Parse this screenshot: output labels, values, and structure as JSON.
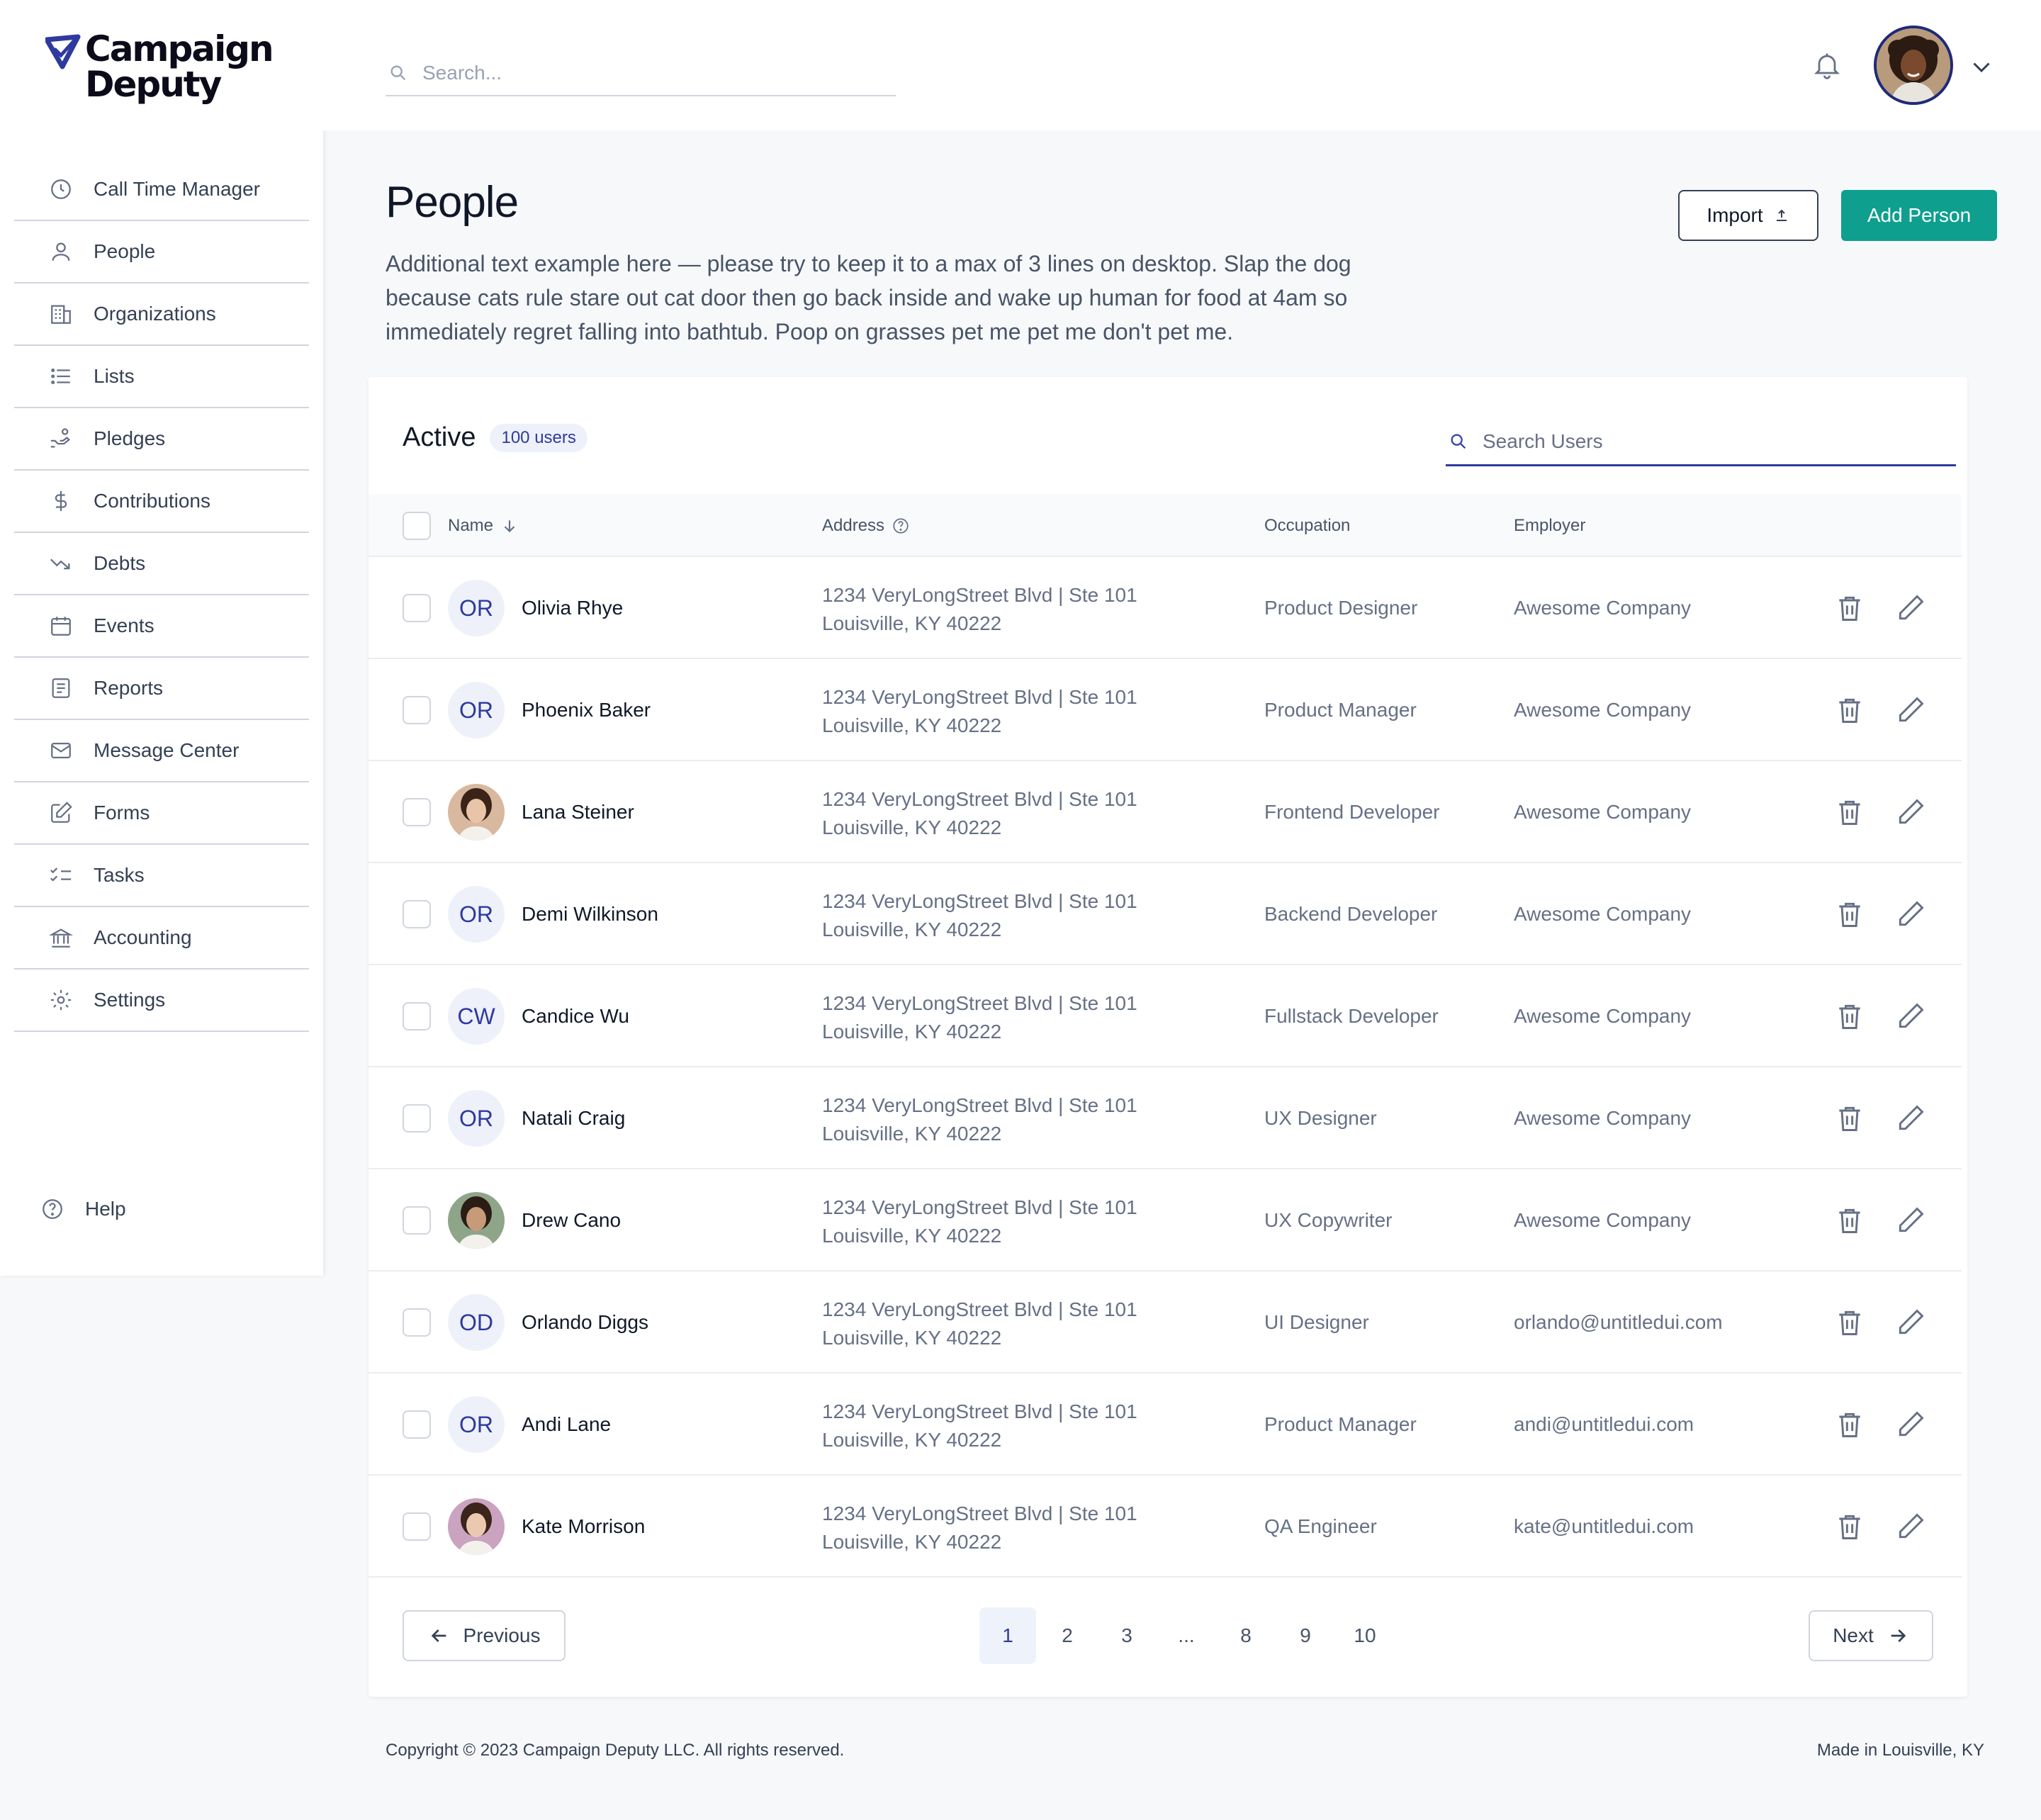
{
  "brand": {
    "line1": "Campaign",
    "line2": "Deputy",
    "accent": "#2E3A9E"
  },
  "search": {
    "placeholder": "Search..."
  },
  "sidebar": {
    "items": [
      {
        "label": "Call Time Manager",
        "icon": "clock-icon"
      },
      {
        "label": "People",
        "icon": "user-icon"
      },
      {
        "label": "Organizations",
        "icon": "building-icon"
      },
      {
        "label": "Lists",
        "icon": "list-icon"
      },
      {
        "label": "Pledges",
        "icon": "hand-coins-icon"
      },
      {
        "label": "Contributions",
        "icon": "dollar-icon"
      },
      {
        "label": "Debts",
        "icon": "trend-down-icon"
      },
      {
        "label": "Events",
        "icon": "calendar-icon"
      },
      {
        "label": "Reports",
        "icon": "report-icon"
      },
      {
        "label": "Message Center",
        "icon": "mail-icon"
      },
      {
        "label": "Forms",
        "icon": "edit-form-icon"
      },
      {
        "label": "Tasks",
        "icon": "tasks-icon"
      },
      {
        "label": "Accounting",
        "icon": "bank-icon"
      },
      {
        "label": "Settings",
        "icon": "gear-icon"
      }
    ],
    "help": "Help"
  },
  "header": {
    "title": "People",
    "description": "Additional text example here — please try to keep it to a max of 3 lines on desktop. Slap the dog because cats rule stare out cat door then go back inside and wake up human for food at 4am so immediately regret falling into bathtub. Poop on grasses pet me pet me don't pet me.",
    "import_label": "Import",
    "add_label": "Add Person",
    "add_color": "#0E9F8E"
  },
  "table": {
    "title": "Active",
    "badge": "100 users",
    "search_placeholder": "Search Users",
    "columns": {
      "name": "Name",
      "address": "Address",
      "occupation": "Occupation",
      "employer": "Employer"
    },
    "rows": [
      {
        "initials": "OR",
        "photo": false,
        "name": "Olivia Rhye",
        "addr1": "1234 VeryLongStreet Blvd | Ste 101",
        "addr2": "Louisville, KY 40222",
        "occupation": "Product Designer",
        "employer": "Awesome Company"
      },
      {
        "initials": "OR",
        "photo": false,
        "name": "Phoenix Baker",
        "addr1": "1234 VeryLongStreet Blvd | Ste 101",
        "addr2": "Louisville, KY 40222",
        "occupation": "Product Manager",
        "employer": "Awesome Company"
      },
      {
        "initials": "",
        "photo": true,
        "name": "Lana Steiner",
        "addr1": "1234 VeryLongStreet Blvd | Ste 101",
        "addr2": "Louisville, KY 40222",
        "occupation": "Frontend Developer",
        "employer": "Awesome Company"
      },
      {
        "initials": "OR",
        "photo": false,
        "name": "Demi Wilkinson",
        "addr1": "1234 VeryLongStreet Blvd | Ste 101",
        "addr2": "Louisville, KY 40222",
        "occupation": "Backend Developer",
        "employer": "Awesome Company"
      },
      {
        "initials": "CW",
        "photo": false,
        "name": "Candice Wu",
        "addr1": "1234 VeryLongStreet Blvd | Ste 101",
        "addr2": "Louisville, KY 40222",
        "occupation": "Fullstack Developer",
        "employer": "Awesome Company"
      },
      {
        "initials": "OR",
        "photo": false,
        "name": "Natali Craig",
        "addr1": "1234 VeryLongStreet Blvd | Ste 101",
        "addr2": "Louisville, KY 40222",
        "occupation": "UX Designer",
        "employer": "Awesome Company"
      },
      {
        "initials": "",
        "photo": true,
        "name": "Drew Cano",
        "addr1": "1234 VeryLongStreet Blvd | Ste 101",
        "addr2": "Louisville, KY 40222",
        "occupation": "UX Copywriter",
        "employer": "Awesome Company"
      },
      {
        "initials": "OD",
        "photo": false,
        "name": "Orlando Diggs",
        "addr1": "1234 VeryLongStreet Blvd | Ste 101",
        "addr2": "Louisville, KY 40222",
        "occupation": "UI Designer",
        "employer": "orlando@untitledui.com"
      },
      {
        "initials": "OR",
        "photo": false,
        "name": "Andi Lane",
        "addr1": "1234 VeryLongStreet Blvd | Ste 101",
        "addr2": "Louisville, KY 40222",
        "occupation": "Product Manager",
        "employer": "andi@untitledui.com"
      },
      {
        "initials": "",
        "photo": true,
        "name": "Kate Morrison",
        "addr1": "1234 VeryLongStreet Blvd | Ste 101",
        "addr2": "Louisville, KY 40222",
        "occupation": "QA Engineer",
        "employer": "kate@untitledui.com"
      }
    ]
  },
  "pagination": {
    "previous": "Previous",
    "next": "Next",
    "pages": [
      "1",
      "2",
      "3",
      "...",
      "8",
      "9",
      "10"
    ],
    "current": "1"
  },
  "footer": {
    "copyright": "Copyright © 2023 Campaign Deputy LLC. All rights reserved.",
    "made_in": "Made in Louisville, KY"
  }
}
